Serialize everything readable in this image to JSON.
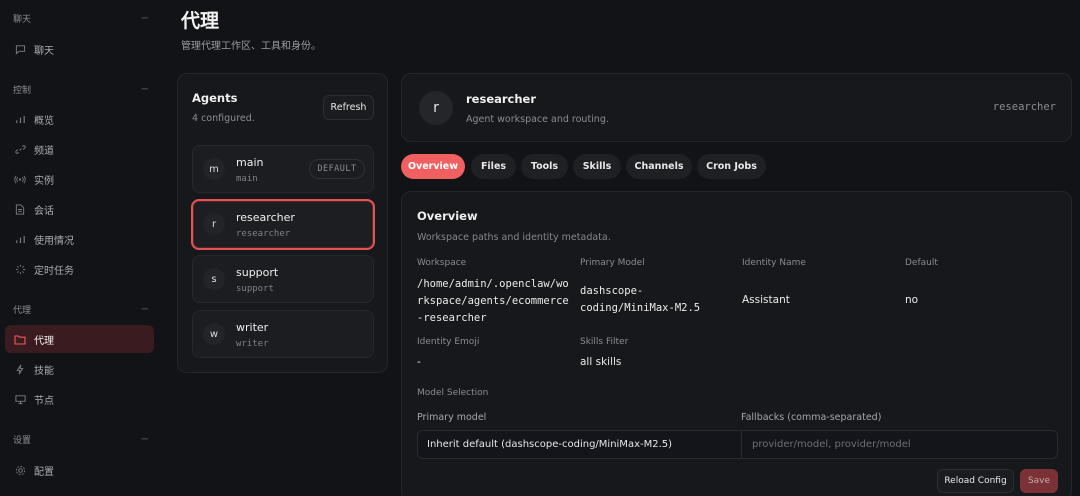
{
  "sidebar": {
    "groups": [
      {
        "label": "聊天",
        "items": [
          {
            "label": "聊天",
            "icon": "chat-bubble-icon"
          }
        ]
      },
      {
        "label": "控制",
        "items": [
          {
            "label": "概览",
            "icon": "bar-chart-icon"
          },
          {
            "label": "频道",
            "icon": "link-icon"
          },
          {
            "label": "实例",
            "icon": "broadcast-icon"
          },
          {
            "label": "会话",
            "icon": "document-icon"
          },
          {
            "label": "使用情况",
            "icon": "bar-chart-icon"
          },
          {
            "label": "定时任务",
            "icon": "spinner-icon"
          }
        ]
      },
      {
        "label": "代理",
        "items": [
          {
            "label": "代理",
            "icon": "folder-icon",
            "active": true
          },
          {
            "label": "技能",
            "icon": "lightning-icon"
          },
          {
            "label": "节点",
            "icon": "monitor-icon"
          }
        ]
      },
      {
        "label": "设置",
        "items": [
          {
            "label": "配置",
            "icon": "gear-icon"
          }
        ]
      }
    ],
    "collapse_glyph": "−"
  },
  "header": {
    "title": "代理",
    "subtitle": "管理代理工作区、工具和身份。"
  },
  "agents_panel": {
    "title": "Agents",
    "count_text": "4 configured.",
    "refresh_label": "Refresh",
    "agents": [
      {
        "avatar": "m",
        "name": "main",
        "id": "main",
        "badge": "DEFAULT"
      },
      {
        "avatar": "r",
        "name": "researcher",
        "id": "researcher",
        "selected": true
      },
      {
        "avatar": "s",
        "name": "support",
        "id": "support"
      },
      {
        "avatar": "w",
        "name": "writer",
        "id": "writer"
      }
    ]
  },
  "agent_header": {
    "avatar": "r",
    "name": "researcher",
    "description": "Agent workspace and routing.",
    "id": "researcher"
  },
  "tabs": [
    {
      "label": "Overview",
      "active": true
    },
    {
      "label": "Files"
    },
    {
      "label": "Tools"
    },
    {
      "label": "Skills"
    },
    {
      "label": "Channels"
    },
    {
      "label": "Cron Jobs"
    }
  ],
  "overview": {
    "title": "Overview",
    "subtitle": "Workspace paths and identity metadata.",
    "fields": {
      "workspace": {
        "label": "Workspace",
        "lines": [
          "/home/admin/.openclaw/wo",
          "rkspace/agents/ecommerce",
          "-researcher"
        ]
      },
      "primary_model": {
        "label": "Primary Model",
        "lines": [
          "dashscope-",
          "coding/MiniMax-M2.5"
        ]
      },
      "identity_name": {
        "label": "Identity Name",
        "value": "Assistant"
      },
      "default": {
        "label": "Default",
        "value": "no"
      },
      "identity_emoji": {
        "label": "Identity Emoji",
        "value": "-"
      },
      "skills_filter": {
        "label": "Skills Filter",
        "value": "all skills"
      }
    },
    "model_selection_label": "Model Selection",
    "primary_model_label": "Primary model",
    "primary_model_value": "Inherit default (dashscope-coding/MiniMax-M2.5)",
    "fallbacks_label": "Fallbacks (comma-separated)",
    "fallbacks_placeholder": "provider/model, provider/model",
    "reload_label": "Reload Config",
    "save_label": "Save"
  },
  "colors": {
    "accent": "#f06060",
    "active_nav_bg": "#3a1c20",
    "background": "#121316",
    "card": "#17181c"
  }
}
